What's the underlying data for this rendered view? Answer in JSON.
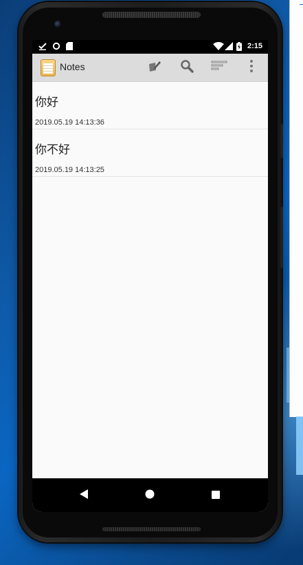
{
  "status_bar": {
    "time": "2:15",
    "left_icons": [
      "download-done-icon",
      "circle-icon",
      "sd-card-icon"
    ],
    "right_icons": [
      "wifi-icon",
      "cell-signal-icon",
      "battery-charging-icon"
    ]
  },
  "action_bar": {
    "title": "Notes",
    "actions": [
      "new-note-icon",
      "search-icon",
      "sort-icon",
      "overflow-menu-icon"
    ]
  },
  "notes": [
    {
      "title": "你好",
      "date": "2019.05.19 14:13:36"
    },
    {
      "title": "你不好",
      "date": "2019.05.19 14:13:25"
    }
  ],
  "nav_bar": [
    "back-icon",
    "home-icon",
    "recents-icon"
  ]
}
